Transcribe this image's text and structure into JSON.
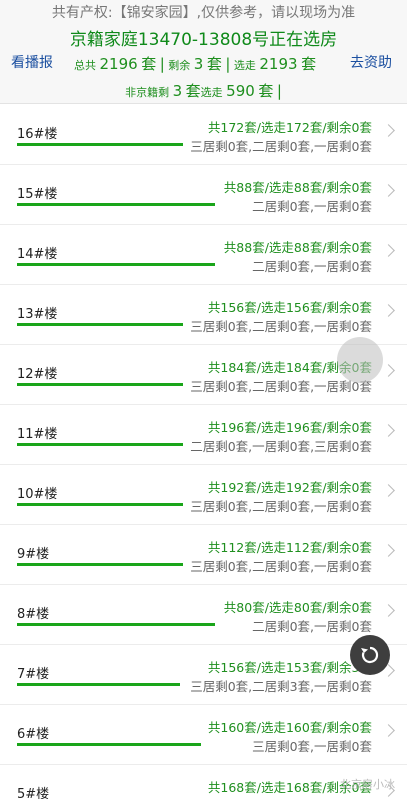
{
  "header": {
    "notice": "共有产权:【锦安家园】,仅供参考，请以现场为准",
    "headline": "京籍家庭13470-13808号正在选房",
    "left_link": "看播报",
    "right_link": "去资助",
    "stats": {
      "total_label": "总共",
      "total_value": "2196",
      "remain_label": "剩余",
      "remain_value": "3",
      "chosen_label": "选走",
      "chosen_value": "2193",
      "unit": "套",
      "sep": "|"
    },
    "stats2": {
      "nonlocal_label": "非京籍剩",
      "nonlocal_value": "3",
      "chosen_label": "选走",
      "chosen_value": "590",
      "unit": "套",
      "sep": "|"
    }
  },
  "buildings": [
    {
      "name": "16#楼",
      "summary": "共172套/选走172套/剩余0套",
      "rooms": "三居剩0套,二居剩0套,一居剩0套",
      "bar": 1.0
    },
    {
      "name": "15#楼",
      "summary": "共88套/选走88套/剩余0套",
      "rooms": "二居剩0套,一居剩0套",
      "bar": 1.0
    },
    {
      "name": "14#楼",
      "summary": "共88套/选走88套/剩余0套",
      "rooms": "二居剩0套,一居剩0套",
      "bar": 1.0
    },
    {
      "name": "13#楼",
      "summary": "共156套/选走156套/剩余0套",
      "rooms": "三居剩0套,二居剩0套,一居剩0套",
      "bar": 1.0
    },
    {
      "name": "12#楼",
      "summary": "共184套/选走184套/剩余0套",
      "rooms": "三居剩0套,二居剩0套,一居剩0套",
      "bar": 1.0
    },
    {
      "name": "11#楼",
      "summary": "共196套/选走196套/剩余0套",
      "rooms": "二居剩0套,一居剩0套,三居剩0套",
      "bar": 1.0
    },
    {
      "name": "10#楼",
      "summary": "共192套/选走192套/剩余0套",
      "rooms": "三居剩0套,二居剩0套,一居剩0套",
      "bar": 1.0
    },
    {
      "name": "9#楼",
      "summary": "共112套/选走112套/剩余0套",
      "rooms": "三居剩0套,二居剩0套,一居剩0套",
      "bar": 1.0
    },
    {
      "name": "8#楼",
      "summary": "共80套/选走80套/剩余0套",
      "rooms": "二居剩0套,一居剩0套",
      "bar": 1.0
    },
    {
      "name": "7#楼",
      "summary": "共156套/选走153套/剩余3套",
      "rooms": "三居剩0套,二居剩3套,一居剩0套",
      "bar": 0.98
    },
    {
      "name": "6#楼",
      "summary": "共160套/选走160套/剩余0套",
      "rooms": "三居剩0套,一居剩0套",
      "bar": 1.0
    },
    {
      "name": "5#楼",
      "summary": "共168套/选走168套/剩余0套",
      "rooms": "",
      "bar": 1.0
    }
  ],
  "watermark": "北京房小冰"
}
